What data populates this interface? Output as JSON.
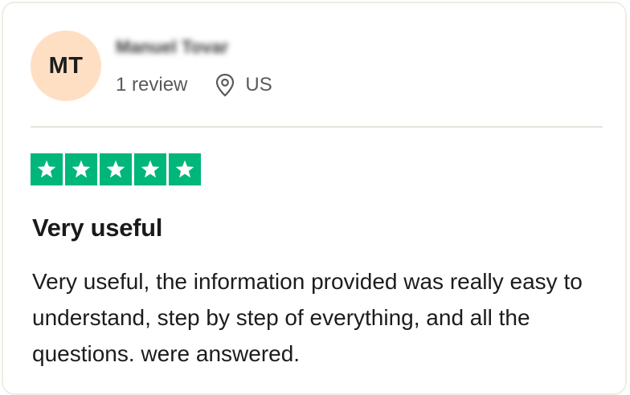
{
  "reviewer": {
    "initials": "MT",
    "name": "Manuel Tovar",
    "review_count": "1 review",
    "location": "US",
    "location_icon": "location-pin-icon",
    "avatar_color": "#ffdfc4"
  },
  "review": {
    "rating": 5,
    "rating_max": 5,
    "star_color": "#00b67a",
    "star_icon": "star-icon",
    "title": "Very useful",
    "body": "Very useful, the information provided was really easy to understand, step by step of everything, and all the questions. were answered."
  }
}
